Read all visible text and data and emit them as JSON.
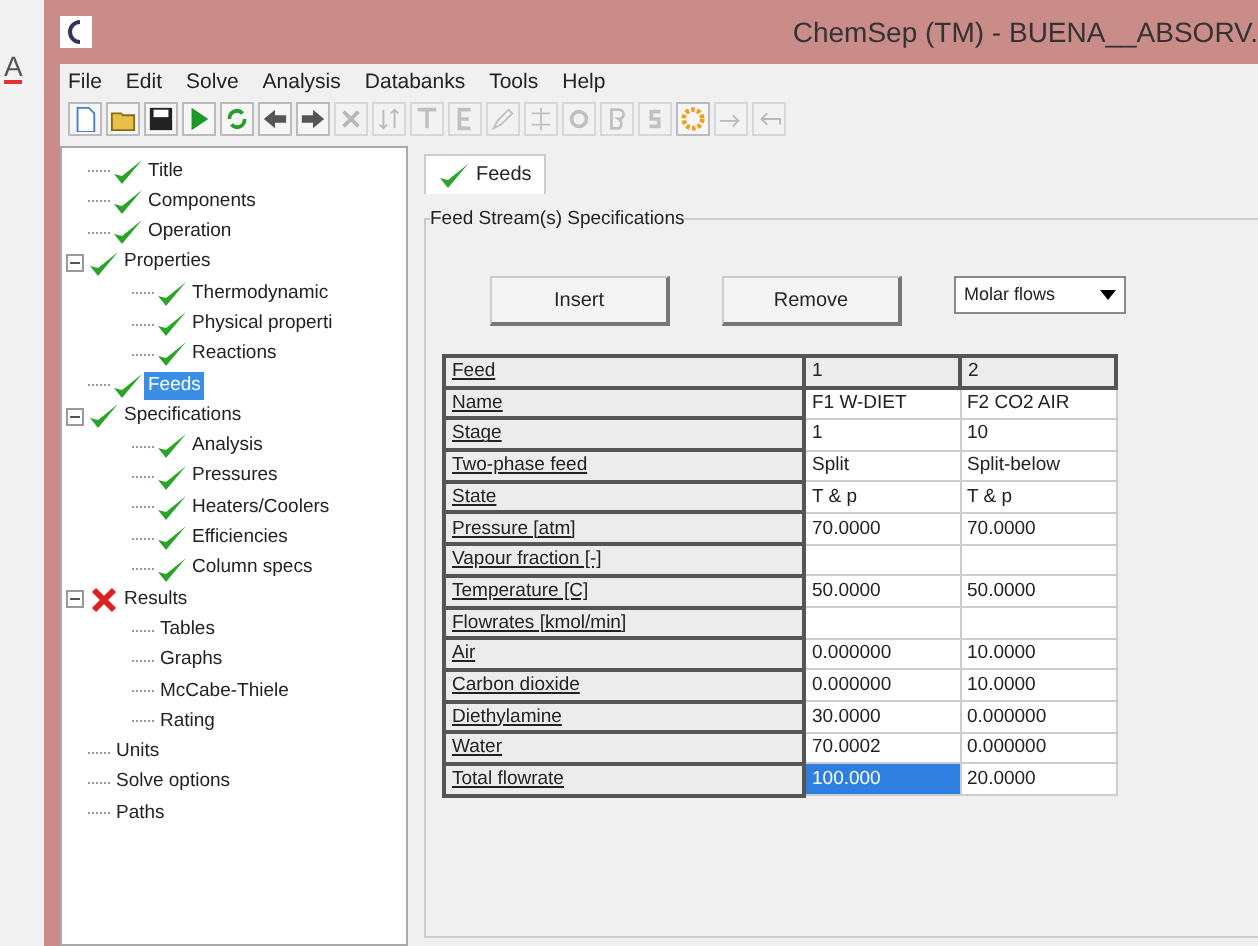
{
  "background_app": {
    "text": "A"
  },
  "window": {
    "title": "ChemSep (TM) - BUENA__ABSORV."
  },
  "menu": [
    "File",
    "Edit",
    "Solve",
    "Analysis",
    "Databanks",
    "Tools",
    "Help"
  ],
  "toolbar": [
    {
      "kind": "new",
      "disabled": false
    },
    {
      "kind": "open",
      "disabled": false
    },
    {
      "kind": "save",
      "disabled": false
    },
    {
      "kind": "run",
      "disabled": false
    },
    {
      "kind": "refresh",
      "disabled": false
    },
    {
      "kind": "back",
      "disabled": false
    },
    {
      "kind": "forward",
      "disabled": false
    },
    {
      "kind": "delete",
      "disabled": true
    },
    {
      "kind": "sort",
      "disabled": true
    },
    {
      "kind": "t",
      "disabled": true
    },
    {
      "kind": "e",
      "disabled": true
    },
    {
      "kind": "pen",
      "disabled": true
    },
    {
      "kind": "split",
      "disabled": true
    },
    {
      "kind": "o",
      "disabled": true
    },
    {
      "kind": "b",
      "disabled": true
    },
    {
      "kind": "s",
      "disabled": true
    },
    {
      "kind": "gear",
      "disabled": false
    },
    {
      "kind": "redo",
      "disabled": true
    },
    {
      "kind": "undo",
      "disabled": true
    }
  ],
  "tree": [
    {
      "label": "Title",
      "done": true,
      "error": false,
      "selected": false
    },
    {
      "label": "Components",
      "done": true,
      "error": false,
      "selected": false
    },
    {
      "label": "Operation",
      "done": true,
      "error": false,
      "selected": false
    },
    {
      "label": "Properties",
      "done": true,
      "error": false,
      "selected": false,
      "expanded": true,
      "children": [
        {
          "label": "Thermodynamic",
          "done": true,
          "error": false,
          "selected": false
        },
        {
          "label": "Physical properti",
          "done": true,
          "error": false,
          "selected": false
        },
        {
          "label": "Reactions",
          "done": true,
          "error": false,
          "selected": false
        }
      ]
    },
    {
      "label": "Feeds",
      "done": true,
      "error": false,
      "selected": true
    },
    {
      "label": "Specifications",
      "done": true,
      "error": false,
      "selected": false,
      "expanded": true,
      "children": [
        {
          "label": "Analysis",
          "done": true,
          "error": false,
          "selected": false
        },
        {
          "label": "Pressures",
          "done": true,
          "error": false,
          "selected": false
        },
        {
          "label": "Heaters/Coolers",
          "done": true,
          "error": false,
          "selected": false
        },
        {
          "label": "Efficiencies",
          "done": true,
          "error": false,
          "selected": false
        },
        {
          "label": "Column specs",
          "done": true,
          "error": false,
          "selected": false
        }
      ]
    },
    {
      "label": "Results",
      "done": false,
      "error": true,
      "selected": false,
      "expanded": true,
      "children": [
        {
          "label": "Tables",
          "done": false,
          "error": false,
          "selected": false
        },
        {
          "label": "Graphs",
          "done": false,
          "error": false,
          "selected": false
        },
        {
          "label": "McCabe-Thiele",
          "done": false,
          "error": false,
          "selected": false
        },
        {
          "label": "Rating",
          "done": false,
          "error": false,
          "selected": false
        }
      ]
    },
    {
      "label": "Units",
      "done": false,
      "error": false,
      "selected": false
    },
    {
      "label": "Solve options",
      "done": false,
      "error": false,
      "selected": false
    },
    {
      "label": "Paths",
      "done": false,
      "error": false,
      "selected": false
    }
  ],
  "tabs": [
    {
      "label": "Feeds",
      "done": true,
      "selected": true
    }
  ],
  "group": {
    "title": "Feed Stream(s) Specifications"
  },
  "buttons": [
    "Insert",
    "Remove"
  ],
  "flow_basis": {
    "value": "Molar flows"
  },
  "table": {
    "header": {
      "label": "Feed",
      "cells": [
        "1",
        "2"
      ]
    },
    "rows": [
      {
        "label": "Name",
        "cells": [
          {
            "text": "F1 W-DIET",
            "selected": false
          },
          {
            "text": "F2  CO2 AIR",
            "selected": false
          }
        ]
      },
      {
        "label": "Stage",
        "cells": [
          {
            "text": "1",
            "selected": false
          },
          {
            "text": "10",
            "selected": false
          }
        ]
      },
      {
        "label": "Two-phase feed",
        "cells": [
          {
            "text": "Split",
            "selected": false
          },
          {
            "text": "Split-below",
            "selected": false
          }
        ]
      },
      {
        "label": "State",
        "cells": [
          {
            "text": "T & p",
            "selected": false
          },
          {
            "text": "T & p",
            "selected": false
          }
        ]
      },
      {
        "label": "Pressure [atm]",
        "cells": [
          {
            "text": "70.0000",
            "selected": false
          },
          {
            "text": "70.0000",
            "selected": false
          }
        ]
      },
      {
        "label": "Vapour fraction [-]",
        "cells": [
          {
            "text": "",
            "selected": false
          },
          {
            "text": "",
            "selected": false
          }
        ]
      },
      {
        "label": "Temperature [C]",
        "cells": [
          {
            "text": "50.0000",
            "selected": false
          },
          {
            "text": "50.0000",
            "selected": false
          }
        ]
      },
      {
        "label": "Flowrates [kmol/min]",
        "cells": [
          {
            "text": "",
            "selected": false
          },
          {
            "text": "",
            "selected": false
          }
        ]
      },
      {
        "label": "Air",
        "cells": [
          {
            "text": "0.000000",
            "selected": false
          },
          {
            "text": "10.0000",
            "selected": false
          }
        ]
      },
      {
        "label": "Carbon dioxide",
        "cells": [
          {
            "text": "0.000000",
            "selected": false
          },
          {
            "text": "10.0000",
            "selected": false
          }
        ]
      },
      {
        "label": "Diethylamine",
        "cells": [
          {
            "text": "30.0000",
            "selected": false
          },
          {
            "text": "0.000000",
            "selected": false
          }
        ]
      },
      {
        "label": "Water",
        "cells": [
          {
            "text": "70.0002",
            "selected": false
          },
          {
            "text": "0.000000",
            "selected": false
          }
        ]
      },
      {
        "label": "Total flowrate",
        "cells": [
          {
            "text": "100.000",
            "selected": true
          },
          {
            "text": "20.0000",
            "selected": false
          }
        ]
      }
    ]
  }
}
